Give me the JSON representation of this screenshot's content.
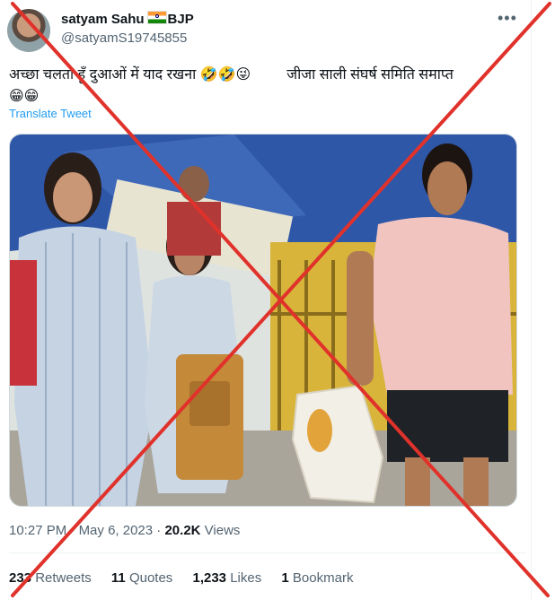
{
  "tweet": {
    "author_name": "satyam Sahu",
    "author_suffix": "BJP",
    "handle": "@satyamS19745855",
    "more_label": "•••",
    "text_part1": "अच्छा चलता हूँ दुआओं में याद रखना 🤣🤣😜",
    "text_part2": "जीजा साली संघर्ष समिति समाप्त",
    "text_emoji": "😁😁",
    "translate_label": "Translate Tweet",
    "time": "10:27 PM",
    "date": "May 6, 2023",
    "views_count": "20.2K",
    "views_label": "Views",
    "separator": "·"
  },
  "stats": [
    {
      "num": "233",
      "label": "Retweets"
    },
    {
      "num": "11",
      "label": "Quotes"
    },
    {
      "num": "1,233",
      "label": "Likes"
    },
    {
      "num": "1",
      "label": "Bookmark"
    }
  ],
  "colors": {
    "cross": "#e0322b",
    "link": "#1d9bf0",
    "secondary": "#536471"
  }
}
